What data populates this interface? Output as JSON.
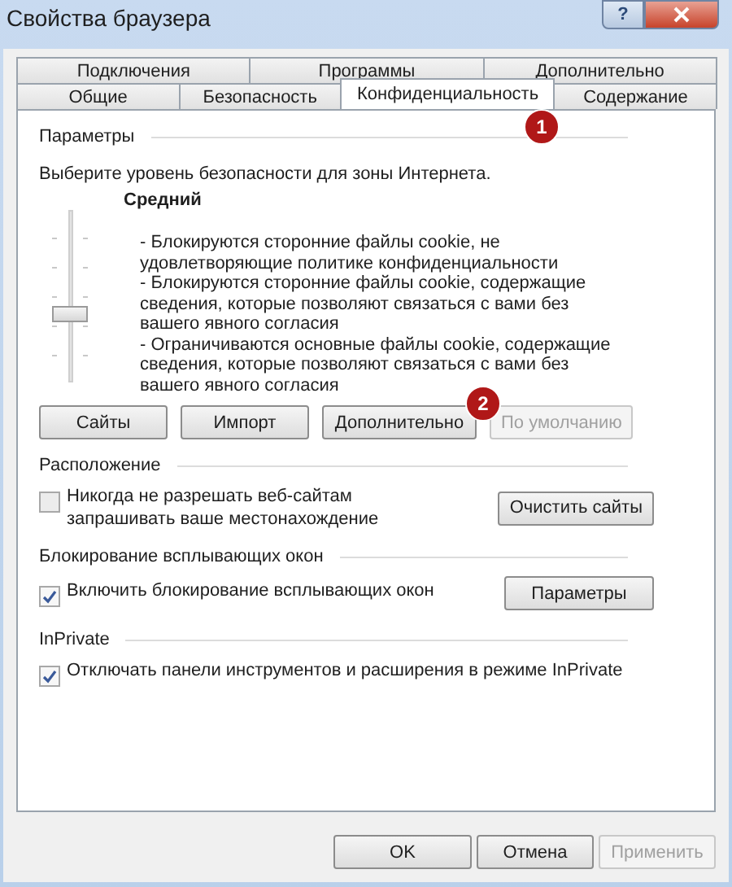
{
  "window": {
    "title": "Свойства браузера",
    "help": "?"
  },
  "tabs": [
    [
      {
        "label": "Подключения",
        "selected": false
      },
      {
        "label": "Программы",
        "selected": false
      },
      {
        "label": "Дополнительно",
        "selected": false
      }
    ],
    [
      {
        "label": "Общие",
        "selected": false
      },
      {
        "label": "Безопасность",
        "selected": false
      },
      {
        "label": "Конфиденциальность",
        "selected": true
      },
      {
        "label": "Содержание",
        "selected": false
      }
    ]
  ],
  "parameters": {
    "title": "Параметры",
    "prompt": "Выберите уровень безопасности для зоны Интернета.",
    "slider": {
      "level": 0.4
    },
    "level_name": "Средний",
    "lines": [
      "- Блокируются сторонние файлы cookie, не удовлетворяющие политике конфиденциальности",
      "- Блокируются сторонние файлы cookie, содержащие сведения, которые позволяют связаться с вами без вашего явного согласия",
      "- Ограничиваются основные файлы cookie, содержащие сведения, которые позволяют связаться с вами без вашего явного согласия"
    ],
    "buttons": [
      {
        "label": "Сайты",
        "disabled": false
      },
      {
        "label": "Импорт",
        "disabled": false
      },
      {
        "label": "Дополнительно",
        "disabled": false
      },
      {
        "label": "По умолчанию",
        "disabled": true
      }
    ]
  },
  "location": {
    "title": "Расположение",
    "checkbox": {
      "label": "Никогда не разрешать веб-сайтам запрашивать ваше местонахождение",
      "checked": false
    },
    "button": "Очистить сайты"
  },
  "popups": {
    "title": "Блокирование всплывающих окон",
    "checkbox": {
      "label": "Включить блокирование всплывающих окон",
      "checked": true
    },
    "button": "Параметры"
  },
  "inprivate": {
    "title": "InPrivate",
    "checkbox": {
      "label": "Отключать панели инструментов и расширения в режиме InPrivate",
      "checked": true
    }
  },
  "footer": [
    {
      "label": "OK",
      "disabled": false
    },
    {
      "label": "Отмена",
      "disabled": false
    },
    {
      "label": "Применить",
      "disabled": true
    }
  ],
  "callouts": [
    {
      "text": "1"
    },
    {
      "text": "2"
    }
  ]
}
